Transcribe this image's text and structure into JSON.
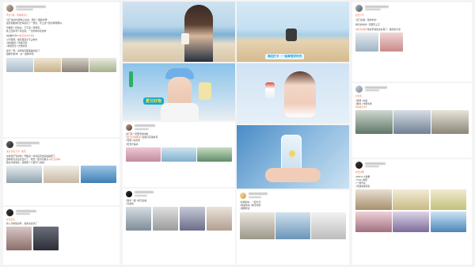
{
  "col1": {
    "post1": {
      "tag": "粤北寻味 · 周末随手记",
      "lines": [
        "\"出门在外也能喝上好水，随手一瓶超方便\"",
        "最近和姐妹们去海边玩了一整天，带上这个随身杯刚刚好，",
        "",
        "早餐配一杯温水，下午来一杯果茶，",
        "晚上回家泡个养生茶，一天的补水就这样",
        "",
        "#好物分享#  #夏日补水计划#",
        "小巧轻便，放包里完全不占地方",
        "√颜值超高   √清爽不腻",
        "√材质安全   √方便清洗",
        "",
        "夏天一到，就想每天都美美的出门",
        "姐妹们快冲！  @一起种草吧"
      ],
      "hl": "#夏日补水计划#"
    },
    "post2": {
      "tag": "来自 夏日打卡 · 超话",
      "lines": [
        "水杯终于到手啦！开箱第一时间就带去海边拍照了，",
        "透明杯身太适合出片了，阳光一照闪闪发亮 #夏日好物#",
        "随身带着喝水，感觉整个人都元气满满~"
      ],
      "hl": "#夏日好物#"
    },
    "post3": {
      "tag": "@某某某",
      "lines": [
        "新入手的随身杯，真的太喜欢了"
      ]
    }
  },
  "col2": {
    "banner_label": "夏日好物",
    "post": {
      "lines": [
        "出门玩一定要带的好物",
        "#夏日好物推荐#  颜值与实用并存",
        "√轻便   √好清洗",
        "√密封不漏水"
      ],
      "hl": "#夏日好物推荐#"
    },
    "post_b": {
      "lines": [
        "√随手一瓶   √夏日必备",
        "√高颜值"
      ]
    }
  },
  "col3": {
    "banner_label": "海边打卡 · 一起享受好时光",
    "post": {
      "lines": [
        "\"好喝的水，一起分享\"",
        "√健康饮水   √携带方便",
        "√透明杯身"
      ]
    }
  },
  "col4": {
    "post1": {
      "tag": "夏日打卡",
      "lines": [
        "\"出门必备，随时补水\"",
        "",
        "旅行的时候一定要带上它",
        "",
        "#夏日好物# 随身杯真的太好用了，推荐给大家"
      ],
      "hl": "#夏日好物#"
    },
    "post2": {
      "tag": "@某某",
      "lines": [
        "√轻便   √好看",
        "√耐摔   √方便清洗",
        "#好物分享#"
      ],
      "hl": "#好物分享#"
    },
    "post3": {
      "tag": "夏日好物",
      "lines": [
        "√800ml 大容量",
        "√Tritan 材质",
        "√一键开盖",
        "√可放车载杯架"
      ]
    }
  }
}
